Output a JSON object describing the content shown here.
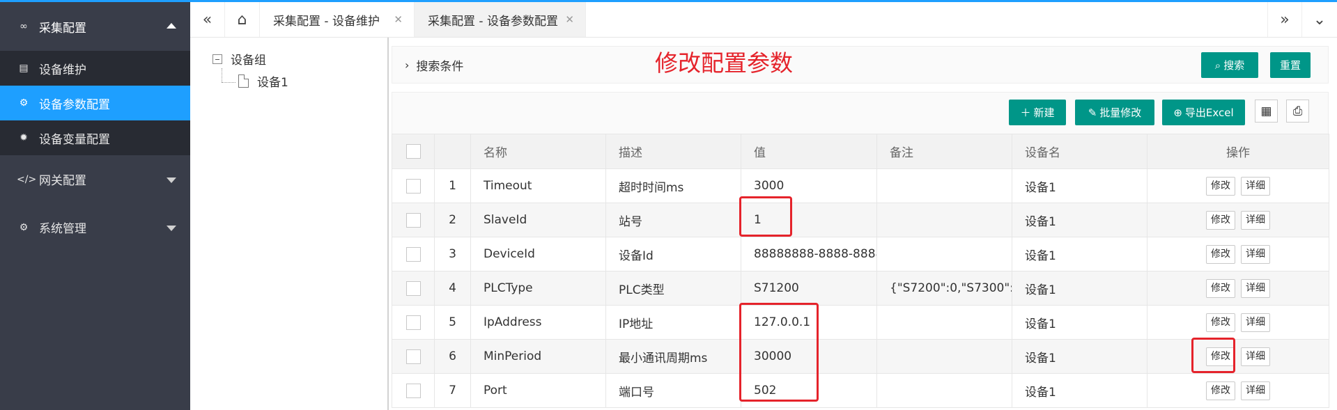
{
  "sidebar": {
    "groups": [
      {
        "label": "采集配置",
        "icon": "link-icon",
        "expanded": true,
        "items": [
          {
            "label": "设备维护",
            "icon": "list-icon",
            "active": false
          },
          {
            "label": "设备参数配置",
            "icon": "gear-icon",
            "active": true
          },
          {
            "label": "设备变量配置",
            "icon": "gear-icon",
            "active": false
          }
        ]
      },
      {
        "label": "网关配置",
        "icon": "code-icon",
        "expanded": false
      },
      {
        "label": "系统管理",
        "icon": "gear-icon",
        "expanded": false
      }
    ]
  },
  "tabs": {
    "items": [
      {
        "label": "采集配置 - 设备维护",
        "active": false
      },
      {
        "label": "采集配置 - 设备参数配置",
        "active": true
      }
    ]
  },
  "tree": {
    "root": "设备组",
    "children": [
      "设备1"
    ]
  },
  "search": {
    "toggle_label": "搜索条件",
    "search_label": "搜索",
    "reset_label": "重置"
  },
  "annotation": "修改配置参数",
  "toolbar": {
    "new_label": "新建",
    "batch_edit_label": "批量修改",
    "export_label": "导出Excel"
  },
  "table": {
    "headers": [
      "名称",
      "描述",
      "值",
      "备注",
      "设备名",
      "操作"
    ],
    "edit_label": "修改",
    "detail_label": "详细",
    "rows": [
      {
        "num": "1",
        "name": "Timeout",
        "desc": "超时时间ms",
        "value": "3000",
        "remark": "",
        "device": "设备1"
      },
      {
        "num": "2",
        "name": "SlaveId",
        "desc": "站号",
        "value": "1",
        "remark": "",
        "device": "设备1"
      },
      {
        "num": "3",
        "name": "DeviceId",
        "desc": "设备Id",
        "value": "88888888-8888-8888-",
        "remark": "",
        "device": "设备1"
      },
      {
        "num": "4",
        "name": "PLCType",
        "desc": "PLC类型",
        "value": "S71200",
        "remark": "{\"S7200\":0,\"S7300\":1,\"",
        "device": "设备1"
      },
      {
        "num": "5",
        "name": "IpAddress",
        "desc": "IP地址",
        "value": "127.0.0.1",
        "remark": "",
        "device": "设备1"
      },
      {
        "num": "6",
        "name": "MinPeriod",
        "desc": "最小通讯周期ms",
        "value": "30000",
        "remark": "",
        "device": "设备1"
      },
      {
        "num": "7",
        "name": "Port",
        "desc": "端口号",
        "value": "502",
        "remark": "",
        "device": "设备1"
      }
    ]
  },
  "colors": {
    "sidebar_bg": "#393d49",
    "sidebar_sub_bg": "#282b33",
    "active_blue": "#1e9fff",
    "primary_green": "#009688",
    "highlight_red": "#e5232b"
  }
}
